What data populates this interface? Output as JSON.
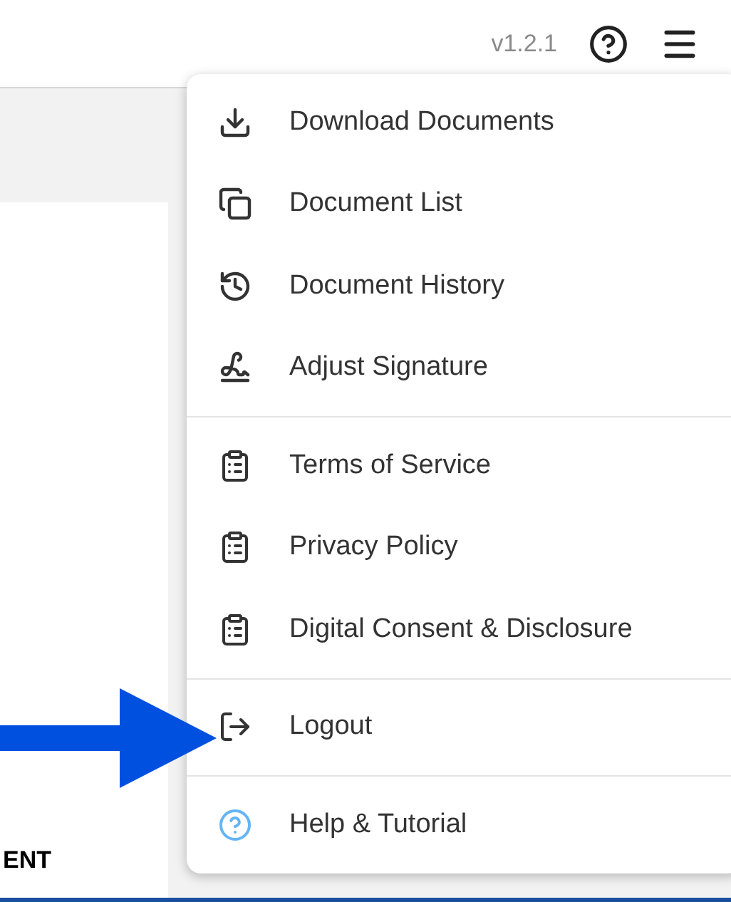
{
  "header": {
    "version": "v1.2.1"
  },
  "document": {
    "fragment": "ENT"
  },
  "menu": {
    "groups": [
      {
        "items": [
          {
            "label": "Download Documents",
            "kind": "download"
          },
          {
            "label": "Document List",
            "kind": "copy"
          },
          {
            "label": "Document History",
            "kind": "history"
          },
          {
            "label": "Adjust Signature",
            "kind": "signature"
          }
        ]
      },
      {
        "items": [
          {
            "label": "Terms of Service",
            "kind": "clipboard"
          },
          {
            "label": "Privacy Policy",
            "kind": "clipboard"
          },
          {
            "label": "Digital Consent & Disclosure",
            "kind": "clipboard"
          }
        ]
      },
      {
        "items": [
          {
            "label": "Logout",
            "kind": "logout"
          }
        ]
      },
      {
        "items": [
          {
            "label": "Help & Tutorial",
            "kind": "help"
          }
        ]
      }
    ]
  }
}
